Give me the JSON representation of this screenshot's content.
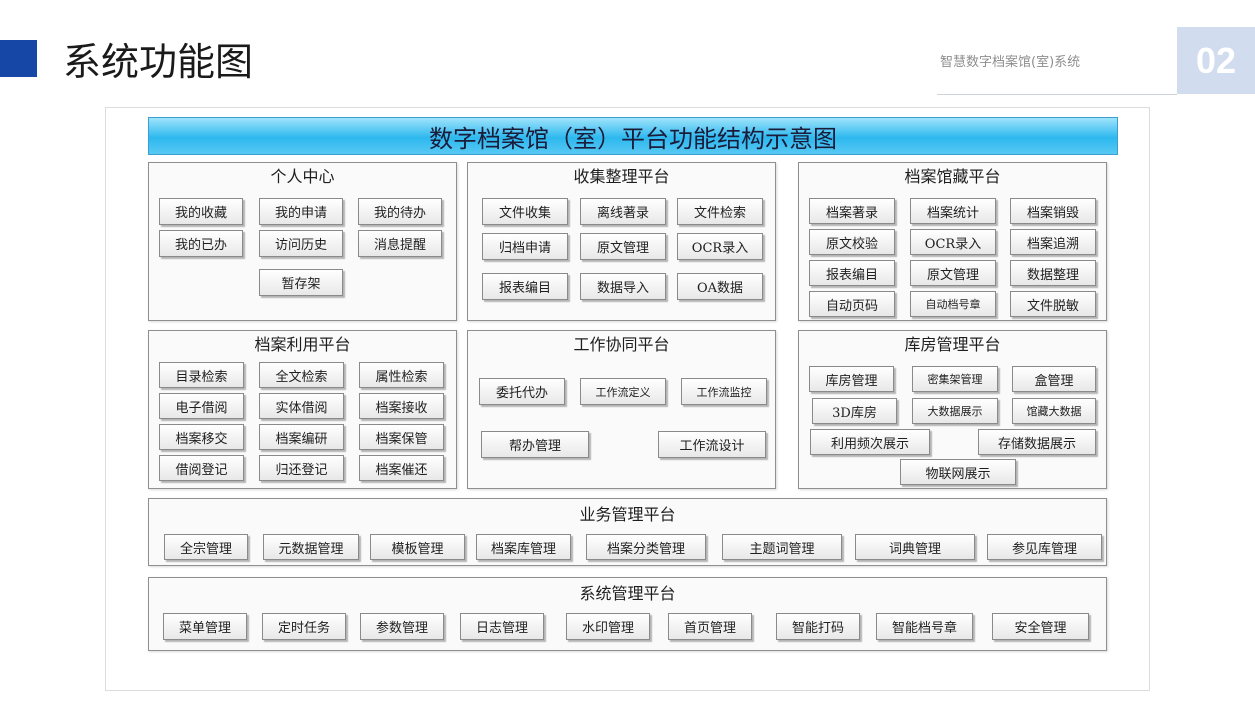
{
  "header": {
    "title": "系统功能图",
    "subtitle": "智慧数字档案馆(室)系统",
    "page_number": "02"
  },
  "diagram": {
    "banner": "数字档案馆（室）平台功能结构示意图",
    "panels": {
      "personal": {
        "title": "个人中心",
        "items": [
          "我的收藏",
          "我的申请",
          "我的待办",
          "我的已办",
          "访问历史",
          "消息提醒",
          "暂存架"
        ]
      },
      "collect": {
        "title": "收集整理平台",
        "items": [
          "文件收集",
          "离线著录",
          "文件检索",
          "归档申请",
          "原文管理",
          "OCR录入",
          "报表编目",
          "数据导入",
          "OA数据"
        ]
      },
      "storage": {
        "title": "档案馆藏平台",
        "items": [
          "档案著录",
          "档案统计",
          "档案销毁",
          "原文校验",
          "OCR录入",
          "档案追溯",
          "报表编目",
          "原文管理",
          "数据整理",
          "自动页码",
          "自动档号章",
          "文件脱敏"
        ]
      },
      "utilize": {
        "title": "档案利用平台",
        "items": [
          "目录检索",
          "全文检索",
          "属性检索",
          "电子借阅",
          "实体借阅",
          "档案接收",
          "档案移交",
          "档案编研",
          "档案保管",
          "借阅登记",
          "归还登记",
          "档案催还"
        ]
      },
      "workflow": {
        "title": "工作协同平台",
        "items": [
          "委托代办",
          "工作流定义",
          "工作流监控",
          "帮办管理",
          "工作流设计"
        ]
      },
      "warehouse": {
        "title": "库房管理平台",
        "items": [
          "库房管理",
          "密集架管理",
          "盒管理",
          "3D库房",
          "大数据展示",
          "馆藏大数据",
          "利用频次展示",
          "存储数据展示",
          "物联网展示"
        ]
      },
      "business": {
        "title": "业务管理平台",
        "items": [
          "全宗管理",
          "元数据管理",
          "模板管理",
          "档案库管理",
          "档案分类管理",
          "主题词管理",
          "词典管理",
          "参见库管理"
        ]
      },
      "system": {
        "title": "系统管理平台",
        "items": [
          "菜单管理",
          "定时任务",
          "参数管理",
          "日志管理",
          "水印管理",
          "首页管理",
          "智能打码",
          "智能档号章",
          "安全管理"
        ]
      }
    }
  },
  "colors": {
    "accent": "#1646a6",
    "banner": "#2db8ef",
    "page_number_bg": "#d2dcef"
  }
}
